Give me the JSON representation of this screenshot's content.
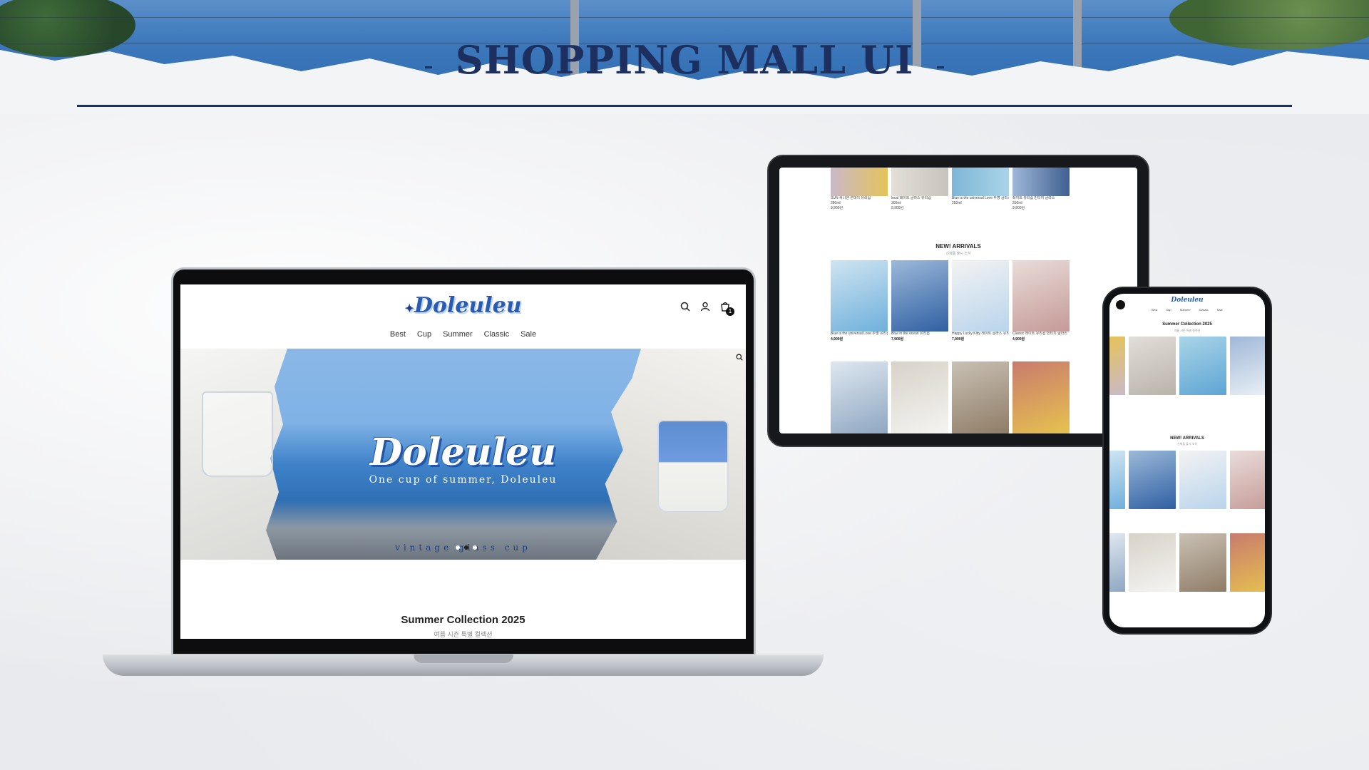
{
  "header": {
    "title": "SHOPPING MALL UI"
  },
  "laptop": {
    "site": {
      "logo": "Doleuleu",
      "nav": [
        "Best",
        "Cup",
        "Summer",
        "Classic",
        "Sale"
      ],
      "cart_count": "1"
    },
    "hero": {
      "title": "Doleuleu",
      "subtitle": "One cup of summer, Doleuleu",
      "tagline": "vintage glass cup",
      "slides": 3,
      "active_slide": 1
    },
    "section": {
      "title": "Summer Collection 2025",
      "subtitle": "여름 시즌 특별 컬렉션"
    }
  },
  "tablet": {
    "top_products": [
      {
        "caption": "SUN 써니엔 썬데이 유리컵",
        "sub": "280ml",
        "price": "9,900원"
      },
      {
        "caption": "local 레이트 글라스 유리컵",
        "sub": "300ml",
        "price": "9,900원"
      },
      {
        "caption": "Blue is the universal Love 투명 글라스 유리컵",
        "sub": "250ml",
        "price": ""
      },
      {
        "caption": "레이트 유리컵 빈티지 글라스",
        "sub": "250ml",
        "price": "9,900원"
      }
    ],
    "new_arrivals": {
      "title": "NEW! ARRIVALS",
      "subtitle": "신제품 출시 소식",
      "row1": [
        {
          "caption": "Blue is the universal Love 투명 유리컵",
          "price": "4,900원"
        },
        {
          "caption": "Blue in the ocean 유리컵",
          "price": "7,900원"
        },
        {
          "caption": "Happy Lucky Kitty 레이트 글라스 유리컵",
          "price": "7,900원"
        },
        {
          "caption": "Classic 레이트 유리컵 빈티지 글라스",
          "price": "4,900원"
        }
      ]
    }
  },
  "phone": {
    "logo": "Doleuleu",
    "nav": [
      "Best",
      "Cup",
      "Summer",
      "Classic",
      "Sale"
    ],
    "section_title": "Summer Collection 2025",
    "section_sub": "여름 시즌 특별 컬렉션",
    "new_arrivals_title": "NEW! ARRIVALS",
    "new_arrivals_sub": "신제품 출시 소식"
  }
}
